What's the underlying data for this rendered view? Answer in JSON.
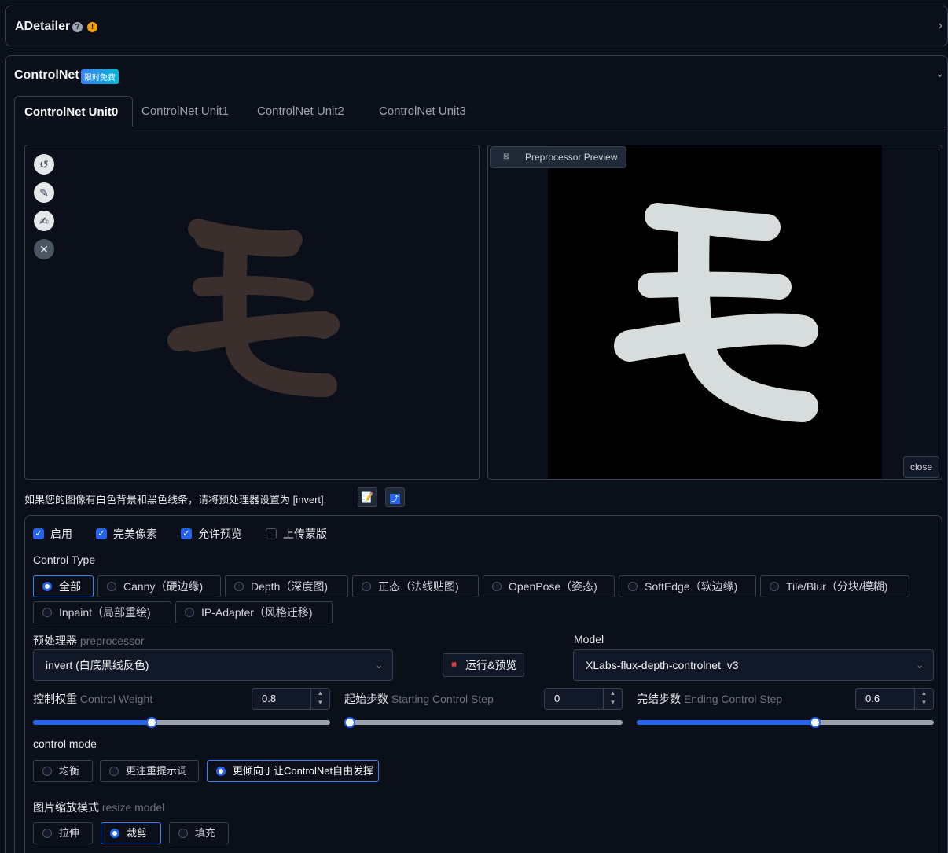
{
  "adetailer": {
    "title": "ADetailer",
    "help_icon": "question-icon",
    "warn_icon": "warning-icon"
  },
  "controlnet": {
    "title": "ControlNet",
    "badge": "限时免费",
    "tabs": [
      "ControlNet Unit0",
      "ControlNet Unit1",
      "ControlNet Unit2",
      "ControlNet Unit3"
    ],
    "preview_label": "Preprocessor Preview",
    "close_label": "close",
    "hint": "如果您的图像有白色背景和黑色线条，请将预处理器设置为 [invert].",
    "checkboxes": [
      {
        "label": "启用",
        "checked": true
      },
      {
        "label": "完美像素",
        "checked": true
      },
      {
        "label": "允许预览",
        "checked": true
      },
      {
        "label": "上传蒙版",
        "checked": false
      }
    ],
    "control_type_label": "Control Type",
    "control_types": [
      "全部",
      "Canny（硬边缘)",
      "Depth（深度图)",
      "正态（法线贴图)",
      "OpenPose（姿态)",
      "SoftEdge（软边缘)",
      "Tile/Blur（分块/模糊)",
      "Inpaint（局部重绘)",
      "IP-Adapter（风格迁移)"
    ],
    "control_type_selected": "全部",
    "preprocessor_label_cn": "预处理器",
    "preprocessor_label_en": "preprocessor",
    "preprocessor_value": "invert (白底黑线反色)",
    "run_label": "运行&预览",
    "model_label": "Model",
    "model_value": "XLabs-flux-depth-controlnet_v3",
    "weight_label_cn": "控制权重",
    "weight_label_en": "Control Weight",
    "weight_value": "0.8",
    "start_label_cn": "起始步数",
    "start_label_en": "Starting Control Step",
    "start_value": "0",
    "end_label_cn": "完结步数",
    "end_label_en": "Ending Control Step",
    "end_value": "0.6",
    "control_mode_label": "control mode",
    "control_modes": [
      "均衡",
      "更注重提示词",
      "更倾向于让ControlNet自由发挥"
    ],
    "control_mode_selected": "更倾向于让ControlNet自由发挥",
    "resize_label_cn": "图片缩放模式",
    "resize_label_en": "resize model",
    "resize_modes": [
      "拉伸",
      "裁剪",
      "填充"
    ],
    "resize_selected": "裁剪"
  },
  "slider_levels": {
    "weight": 0.4,
    "start": 0.0,
    "end": 0.6
  },
  "colors": {
    "accent": "#2563eb",
    "bg": "#0b0f19",
    "stroke_left": "#3a2f2c",
    "stroke_right": "#d7dcdc"
  }
}
